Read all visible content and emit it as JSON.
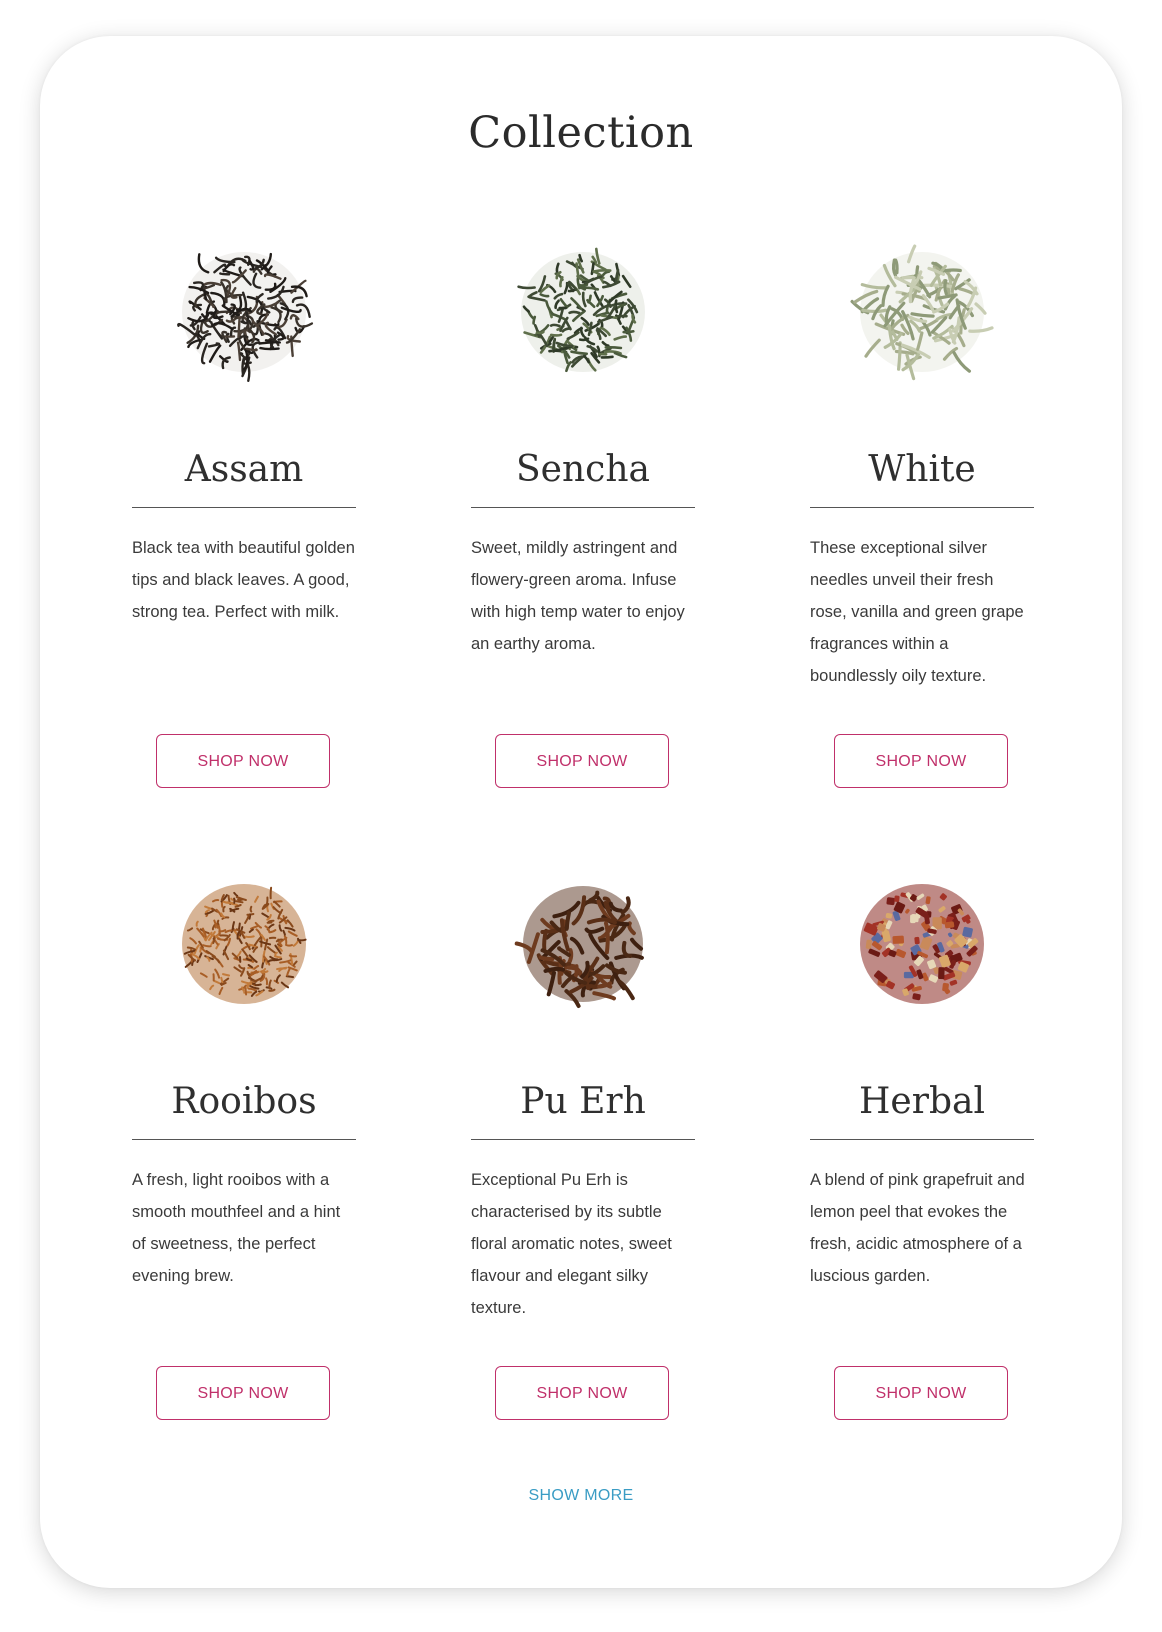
{
  "collection": {
    "title": "Collection",
    "show_more_label": "SHOW MORE",
    "accent_color": "#c0306a",
    "link_color": "#3a9cc4",
    "products": [
      {
        "name": "Assam",
        "description": "Black tea with beautiful golden tips and black leaves. A good, strong tea. Perfect with milk.",
        "button_label": "SHOP NOW",
        "image": "assam-tea-leaves-image"
      },
      {
        "name": "Sencha",
        "description": "Sweet, mildly astringent and flowery-green aroma. Infuse with high temp water to enjoy an earthy aroma.",
        "button_label": "SHOP NOW",
        "image": "sencha-tea-leaves-image"
      },
      {
        "name": "White",
        "description": "These exceptional silver needles unveil their fresh rose, vanilla and green grape fragrances within a boundlessly oily texture.",
        "button_label": "SHOP NOW",
        "image": "white-tea-leaves-image"
      },
      {
        "name": "Rooibos",
        "description": "A fresh, light rooibos with a smooth mouthfeel and a hint of sweetness, the perfect evening brew.",
        "button_label": "SHOP NOW",
        "image": "rooibos-tea-leaves-image"
      },
      {
        "name": "Pu Erh",
        "description": "Exceptional Pu Erh is characterised by its subtle floral aromatic notes, sweet flavour and elegant silky texture.",
        "button_label": "SHOP NOW",
        "image": "pu-erh-tea-leaves-image"
      },
      {
        "name": "Herbal",
        "description": "A blend of pink grapefruit and lemon peel that evokes the fresh, acidic atmosphere of a luscious garden.",
        "button_label": "SHOP NOW",
        "image": "herbal-tea-blend-image"
      }
    ]
  }
}
